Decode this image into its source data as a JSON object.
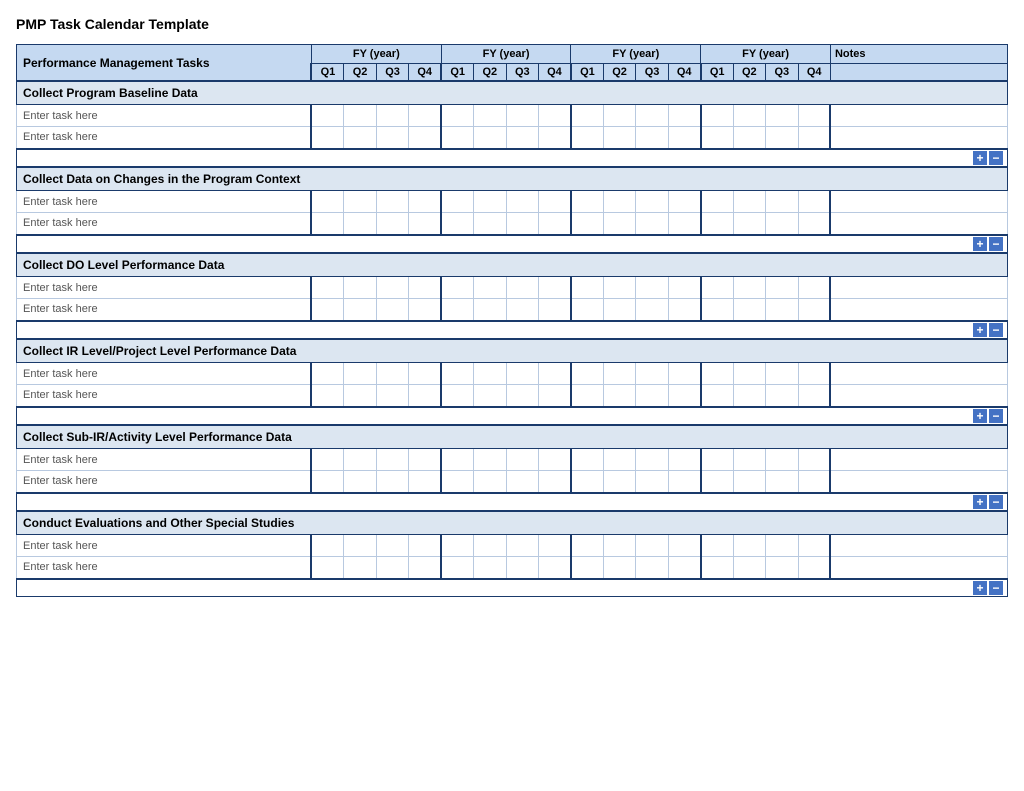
{
  "title": "PMP Task Calendar Template",
  "header": {
    "task_col_label": "Performance Management Tasks",
    "notes_label": "Notes",
    "fy_label": "FY  (year)",
    "quarters": [
      "Q1",
      "Q2",
      "Q3",
      "Q4"
    ]
  },
  "sections": [
    {
      "id": "section-1",
      "label": "Collect Program Baseline Data",
      "tasks": [
        "Enter task here",
        "Enter task here"
      ]
    },
    {
      "id": "section-2",
      "label": "Collect Data on Changes in the Program Context",
      "tasks": [
        "Enter task here",
        "Enter task here"
      ]
    },
    {
      "id": "section-3",
      "label": "Collect DO Level Performance Data",
      "tasks": [
        "Enter task here",
        "Enter task here"
      ]
    },
    {
      "id": "section-4",
      "label": "Collect IR Level/Project Level Performance Data",
      "tasks": [
        "Enter task here",
        "Enter task here"
      ]
    },
    {
      "id": "section-5",
      "label": "Collect Sub-IR/Activity Level Performance Data",
      "tasks": [
        "Enter task here",
        "Enter task here"
      ]
    },
    {
      "id": "section-6",
      "label": "Conduct Evaluations and Other Special Studies",
      "tasks": [
        "Enter task here",
        "Enter task here"
      ]
    }
  ],
  "buttons": {
    "plus": "+",
    "minus": "−"
  }
}
